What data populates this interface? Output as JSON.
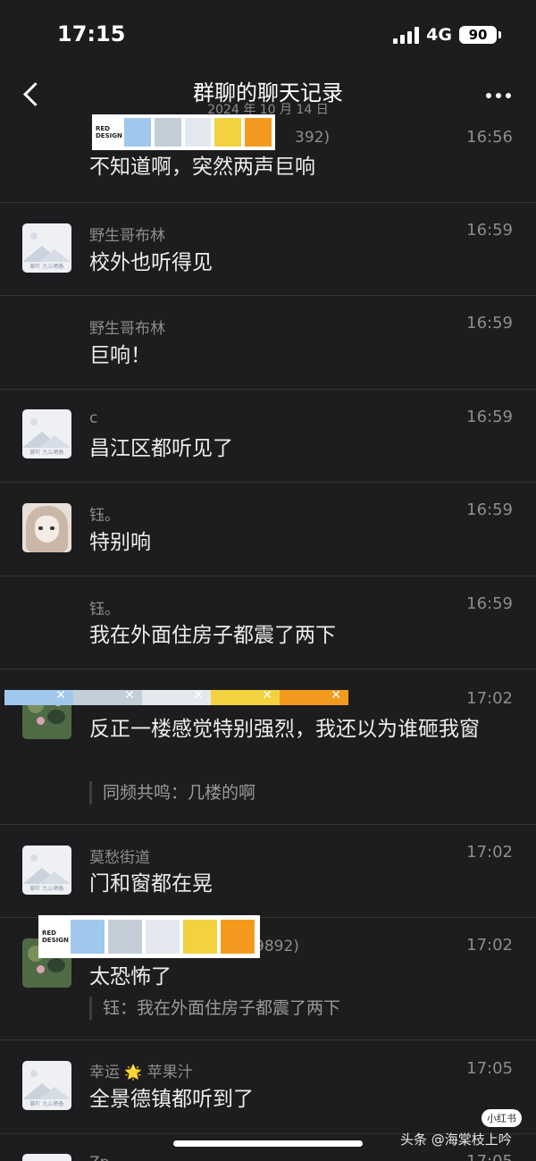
{
  "status_bar": {
    "time": "17:15",
    "network": "4G",
    "battery": "90"
  },
  "header": {
    "title": "群聊的聊天记录",
    "date": "2024 年 10 月 14 日"
  },
  "palette_brand": "RED DESIGN",
  "palette_colors": [
    "#9fc8ec",
    "#c4ced8",
    "#e3e9ee",
    "#f2d23e",
    "#f39a1e"
  ],
  "messages": [
    {
      "sender": "392)",
      "time": "16:56",
      "text": "不知道啊，突然两声巨响"
    },
    {
      "sender": "野生哥布林",
      "time": "16:59",
      "text": "校外也听得见",
      "avatar_caption": "聊吖 九么晒备"
    },
    {
      "sender": "野生哥布林",
      "time": "16:59",
      "text": "巨响！"
    },
    {
      "sender": "c",
      "time": "16:59",
      "text": "昌江区都听见了",
      "avatar_caption": "聊吖 九么晒备"
    },
    {
      "sender": "钰。",
      "time": "16:59",
      "text": "特别响"
    },
    {
      "sender": "钰。",
      "time": "16:59",
      "text": "我在外面住房子都震了两下"
    },
    {
      "sender": "",
      "time": "17:02",
      "text": "反正一楼感觉特别强烈，我还以为谁砸我窗",
      "quote": "同频共鸣：几楼的啊"
    },
    {
      "sender": "莫愁街道",
      "time": "17:02",
      "text": "门和窗都在晃",
      "avatar_caption": "聊吖 九么晒备"
    },
    {
      "sender": "9892)",
      "time": "17:02",
      "text": "太恐怖了",
      "quote": "钰：我在外面住房子都震了两下"
    },
    {
      "sender_a": "幸运",
      "sender_b": "苹果汁",
      "time": "17:05",
      "text": "全景德镇都听到了",
      "avatar_caption": "聊吖 九么晒备"
    },
    {
      "sender": "Zp",
      "time": "17:05"
    }
  ],
  "overlay": {
    "badge": "小红书",
    "watermark": "头条 @海棠枝上吟"
  }
}
